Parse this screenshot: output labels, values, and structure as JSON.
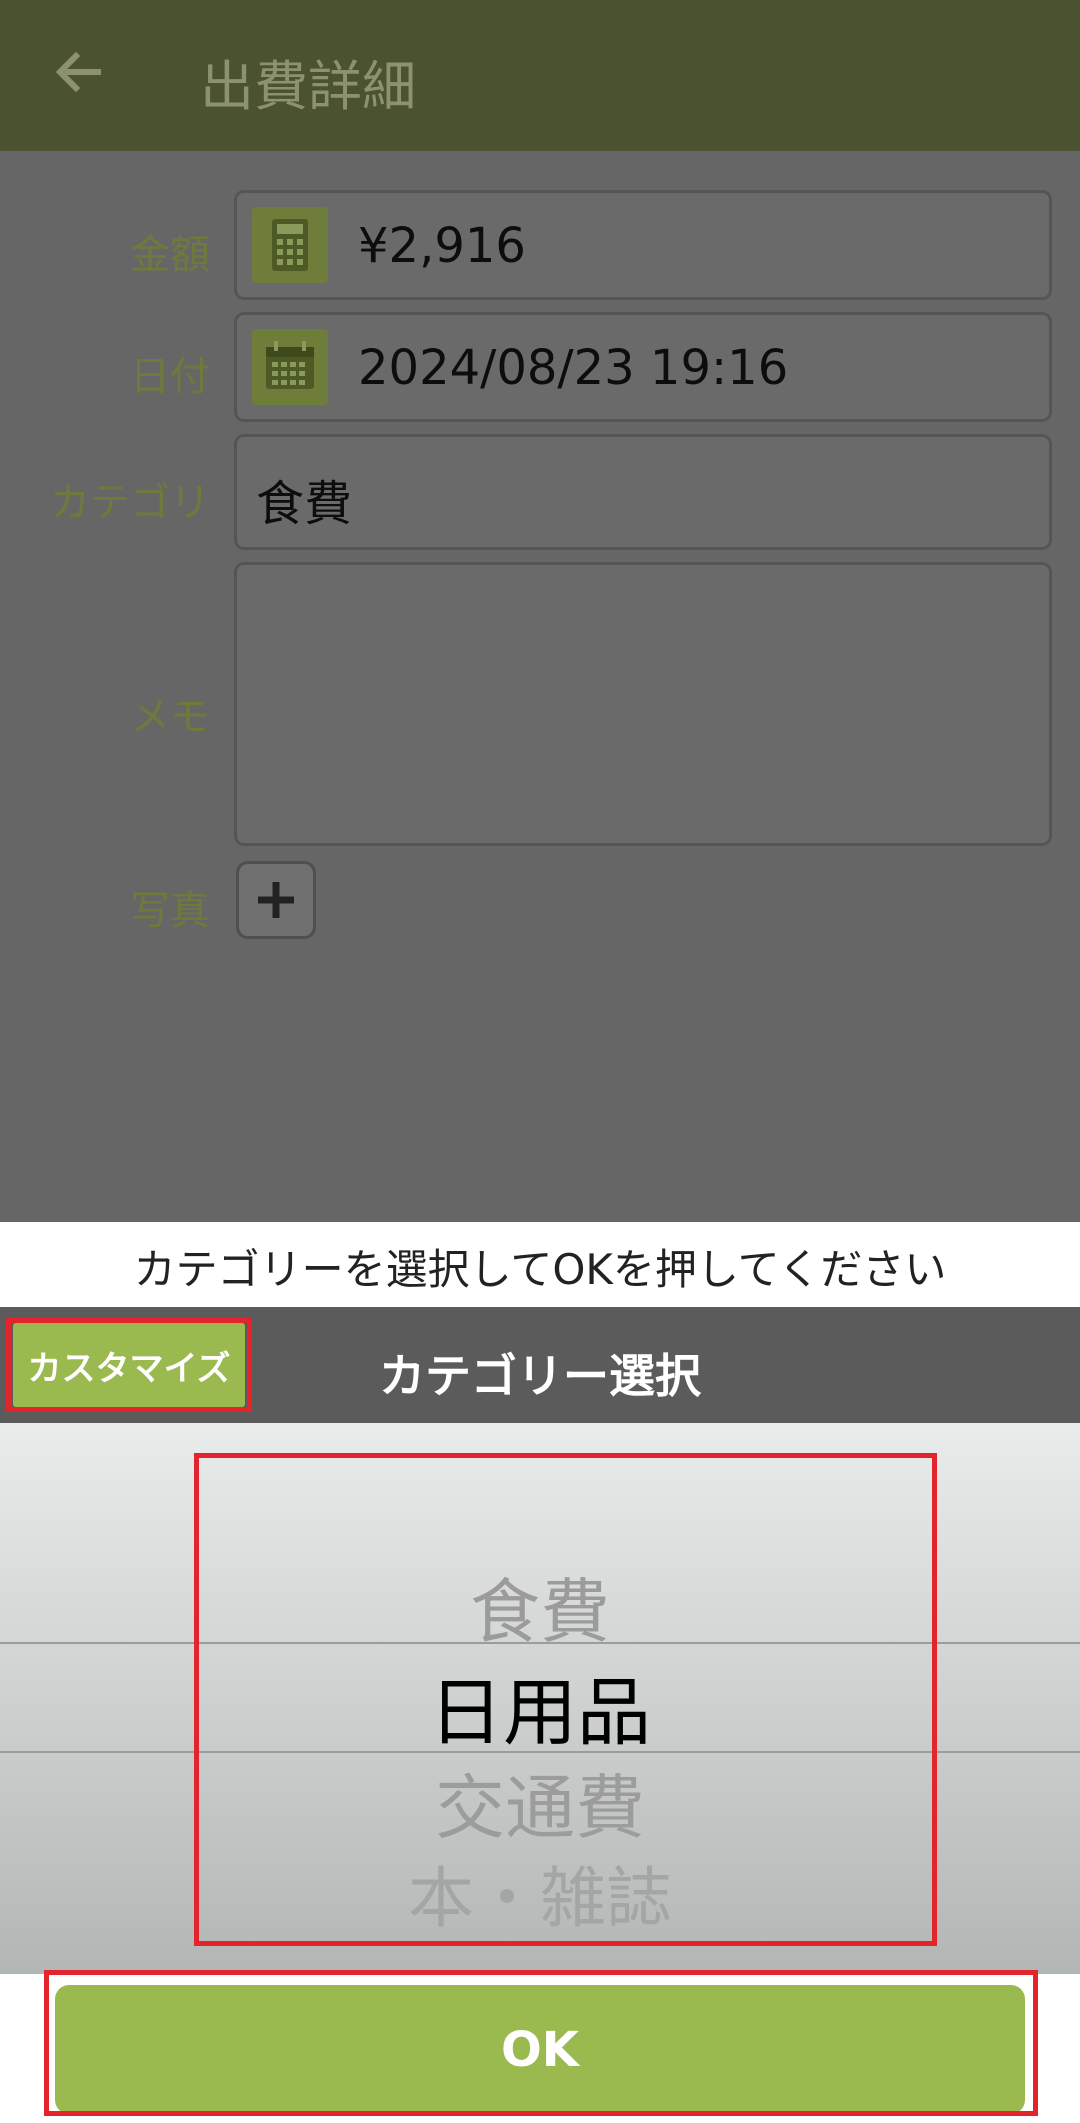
{
  "appbar": {
    "title": "出費詳細"
  },
  "form": {
    "amount_label": "金額",
    "amount_value": "¥2,916",
    "date_label": "日付",
    "date_value": "2024/08/23 19:16",
    "category_label": "カテゴリ",
    "category_value": "食費",
    "memo_label": "メモ",
    "memo_value": "",
    "photo_label": "写真"
  },
  "dialog": {
    "prompt": "カテゴリーを選択してOKを押してください",
    "customize_label": "カスタマイズ",
    "title": "カテゴリー選択",
    "options": [
      "食費",
      "日用品",
      "交通費",
      "本・雑誌"
    ],
    "selected": "日用品",
    "ok_label": "OK"
  },
  "icons": {
    "back": "arrow-left-icon",
    "calculator": "calculator-icon",
    "calendar": "calendar-icon",
    "plus": "plus-icon"
  },
  "colors": {
    "appbar": "#4a5230",
    "accent_green": "#9ab94f",
    "highlight_red": "#e3242b"
  }
}
